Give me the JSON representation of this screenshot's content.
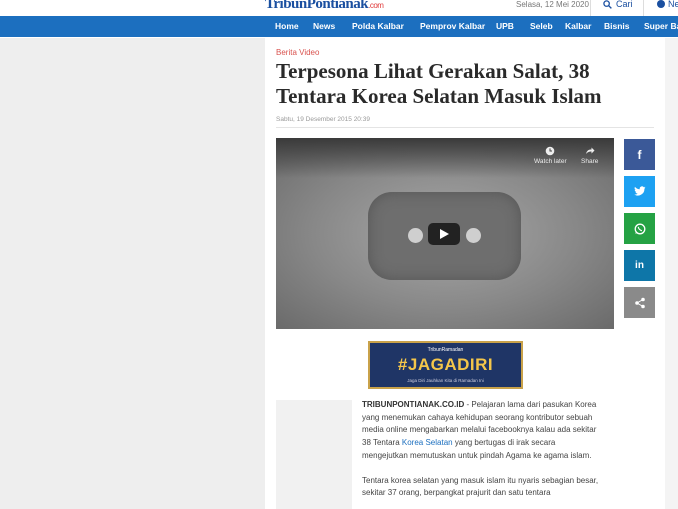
{
  "site": {
    "logo_main": "TribunPontianak",
    "logo_domain": ".com"
  },
  "header": {
    "date": "Selasa, 12 Mei 2020",
    "search_label": "Cari",
    "user_label": "Ne"
  },
  "nav": [
    "Home",
    "News",
    "Polda Kalbar",
    "Pemprov Kalbar",
    "UPB",
    "Seleb",
    "Kalbar",
    "Bisnis",
    "Super Ball"
  ],
  "article": {
    "kicker": "Berita Video",
    "title": "Terpesona Lihat Gerakan Salat, 38 Tentara Korea Selatan Masuk Islam",
    "date": "Sabtu, 19 Desember 2015 20:39",
    "lead_source": "TRIBUNPONTIANAK.CO.ID",
    "para1_a": " - Pelajaran lama dari pasukan Korea yang menemukan cahaya kehidupan seorang kontributor sebuah media online mengabarkan melalui facebooknya kalau ada sekitar 38 Tentara ",
    "para1_link": "Korea Selatan",
    "para1_b": " yang bertugas di irak secara mengejutkan memutuskan untuk pindah Agama ke agama islam.",
    "para2": "Tentara korea selatan yang masuk islam itu nyaris sebagian besar, sekitar 37 orang, berpangkat prajurit dan satu tentara"
  },
  "video": {
    "watch_later": "Watch later",
    "share": "Share",
    "icons": [
      "clock-icon",
      "share-arrow-icon",
      "play-icon"
    ]
  },
  "share_buttons": [
    {
      "name": "facebook",
      "glyph": "f",
      "color": "#3b5998"
    },
    {
      "name": "twitter",
      "glyph": "t",
      "color": "#1da1f2"
    },
    {
      "name": "whatsapp",
      "glyph": "w",
      "color": "#25a244"
    },
    {
      "name": "linkedin",
      "glyph": "in",
      "color": "#0e76a8"
    },
    {
      "name": "share",
      "glyph": "s",
      "color": "#8a8a8a"
    }
  ],
  "banner": {
    "top": "TribunRamadan",
    "main": "#JAGADIRI",
    "tag": "Jaga Diri Jauhkan Kita di Ramadan Ini"
  }
}
